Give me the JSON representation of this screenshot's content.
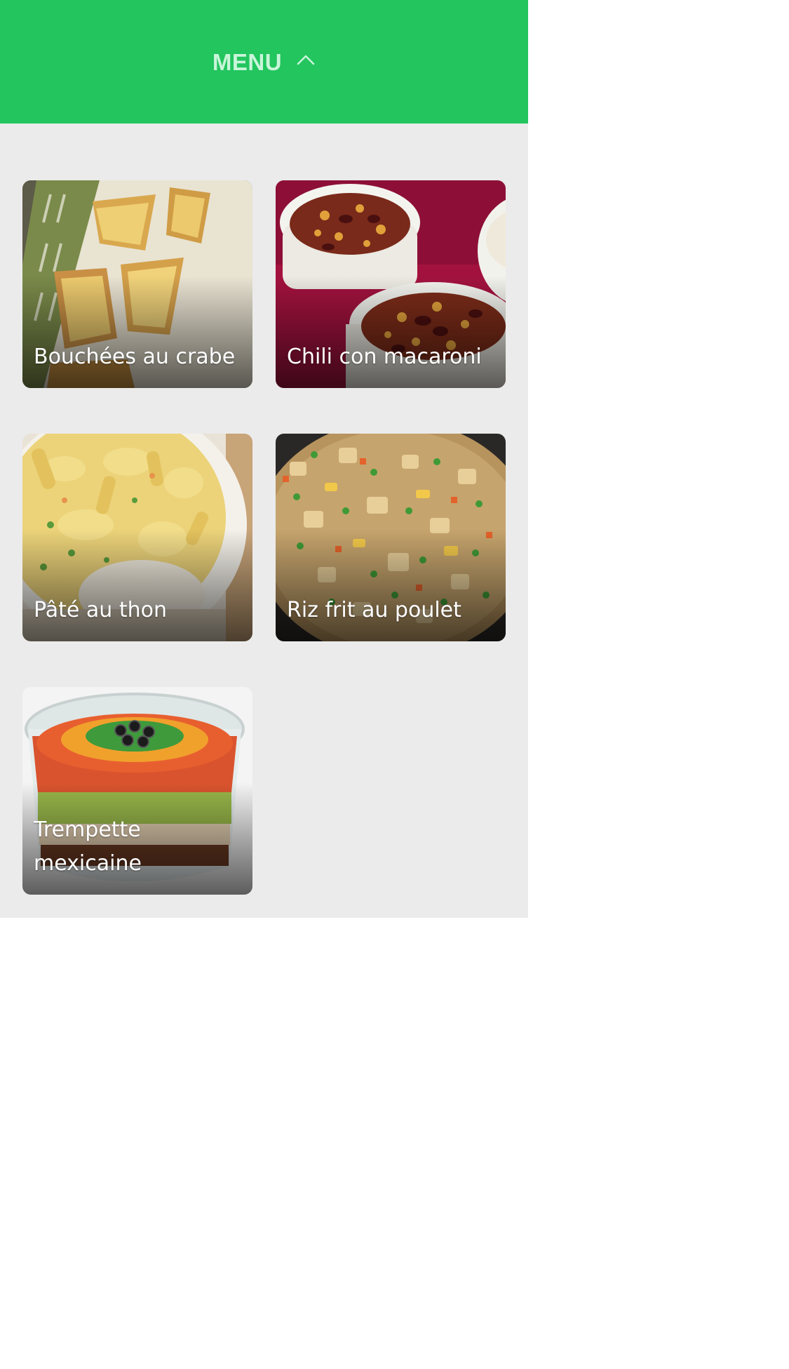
{
  "header": {
    "menu_label": "MENU",
    "toggle_icon": "chevron-up-icon",
    "background": "#22c55e"
  },
  "recipes": [
    {
      "title": "Bouchées au crabe",
      "image": "crab-bites-photo"
    },
    {
      "title": "Chili con macaroni",
      "image": "chili-macaroni-photo"
    },
    {
      "title": "Pâté au thon",
      "image": "tuna-pie-photo"
    },
    {
      "title": "Riz frit au poulet",
      "image": "chicken-fried-rice-photo"
    },
    {
      "title": "Trempette mexicaine",
      "image": "mexican-dip-photo"
    }
  ]
}
